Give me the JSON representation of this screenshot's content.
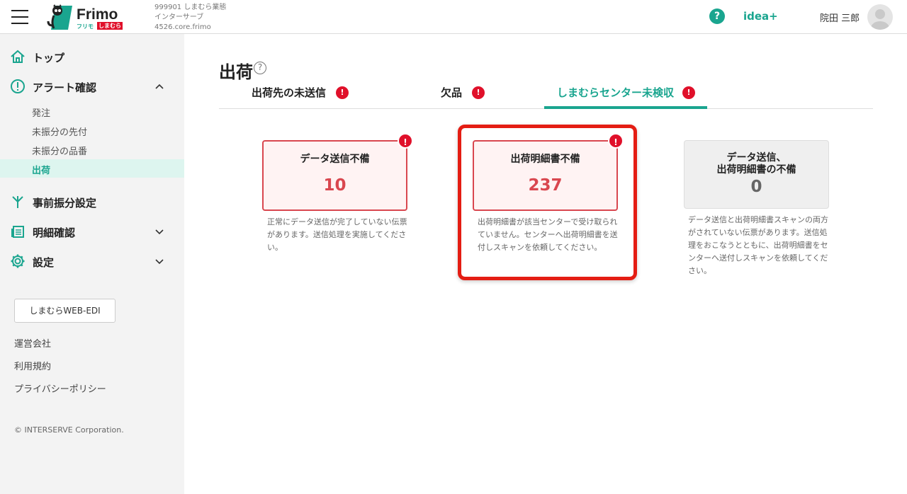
{
  "header": {
    "logo_text": "Frimo",
    "logo_sub_kana": "フリモ",
    "logo_sub_brand": "しまむら",
    "tenant_line1": "999901 しまむら業態",
    "tenant_line2": "インターサーブ",
    "tenant_line3": "4526.core.frimo",
    "help_label": "?",
    "idea_label": "idea+",
    "user_name": "院田 三郎"
  },
  "sidebar": {
    "top_label": "トップ",
    "alert_label": "アラート確認",
    "alert_sub": [
      "発注",
      "未振分の先付",
      "未振分の品番",
      "出荷"
    ],
    "preassign_label": "事前振分設定",
    "detail_label": "明細確認",
    "settings_label": "設定",
    "web_edi_label": "しまむらWEB-EDI",
    "footer_links": [
      "運営会社",
      "利用規約",
      "プライバシーポリシー"
    ],
    "copyright": "© INTERSERVE Corporation."
  },
  "main": {
    "title": "出荷",
    "title_help": "?",
    "tabs": [
      {
        "label": "出荷先の未送信",
        "alert": "!"
      },
      {
        "label": "欠品",
        "alert": "!"
      },
      {
        "label": "しまむらセンター未検収",
        "alert": "!"
      }
    ],
    "cards": [
      {
        "title": "データ送信不備",
        "value": "10",
        "badge": "!",
        "desc": "正常にデータ送信が完了していない伝票があります。送信処理を実施してください。"
      },
      {
        "title": "出荷明細書不備",
        "value": "237",
        "badge": "!",
        "desc": "出荷明細書が該当センターで受け取られていません。センターへ出荷明細書を送付しスキャンを依頼してください。"
      },
      {
        "title_line1": "データ送信、",
        "title_line2": "出荷明細書の不備",
        "value": "0",
        "desc": "データ送信と出荷明細書スキャンの両方がされていない伝票があります。送信処理をおこなうとともに、出荷明細書をセンターへ送付しスキャンを依頼してください。"
      }
    ]
  },
  "colors": {
    "accent": "#1aa58f",
    "alert_red": "#e0102a",
    "card_border": "#d9474f",
    "highlight": "#e41d13"
  }
}
